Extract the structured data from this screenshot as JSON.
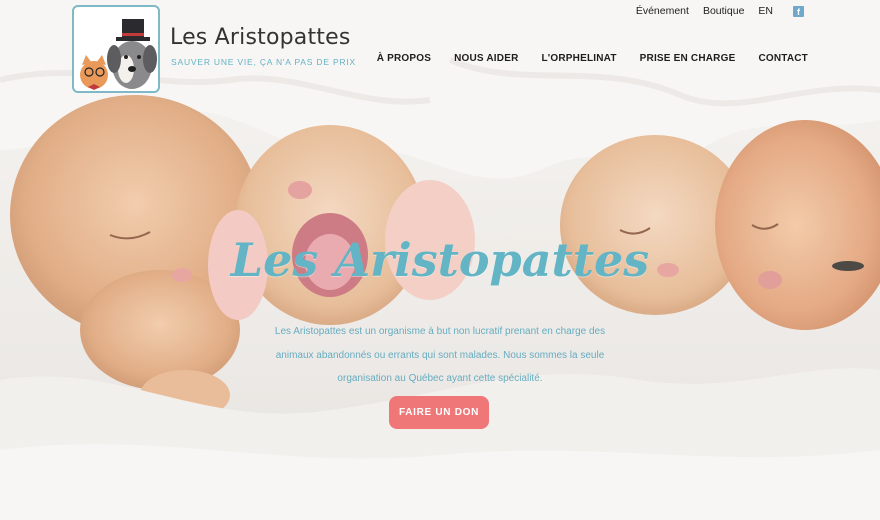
{
  "brand": {
    "name": "Les Aristopattes",
    "tagline": "SAUVER UNE VIE, ÇA N'A PAS DE PRIX"
  },
  "top_links": {
    "event": "Événement",
    "shop": "Boutique",
    "lang": "EN",
    "facebook_glyph": "f"
  },
  "nav": {
    "items": [
      {
        "label": "À PROPOS"
      },
      {
        "label": "NOUS AIDER"
      },
      {
        "label": "L'ORPHELINAT"
      },
      {
        "label": "PRISE EN CHARGE"
      },
      {
        "label": "CONTACT"
      }
    ]
  },
  "hero": {
    "title": "Les Aristopattes",
    "description": "Les Aristopattes est un organisme à but non lucratif prenant en charge des animaux abandonnés ou errants qui sont malades. Nous sommes la seule organisation au Québec ayant cette spécialité.",
    "cta_label": "FAIRE UN DON"
  },
  "colors": {
    "accent_teal": "#63b5c5",
    "cta_coral": "#f07778",
    "logo_border": "#7fb8c6"
  },
  "icons": {
    "logo": "cat-and-dog-with-top-hat-logo",
    "facebook": "facebook-icon"
  }
}
